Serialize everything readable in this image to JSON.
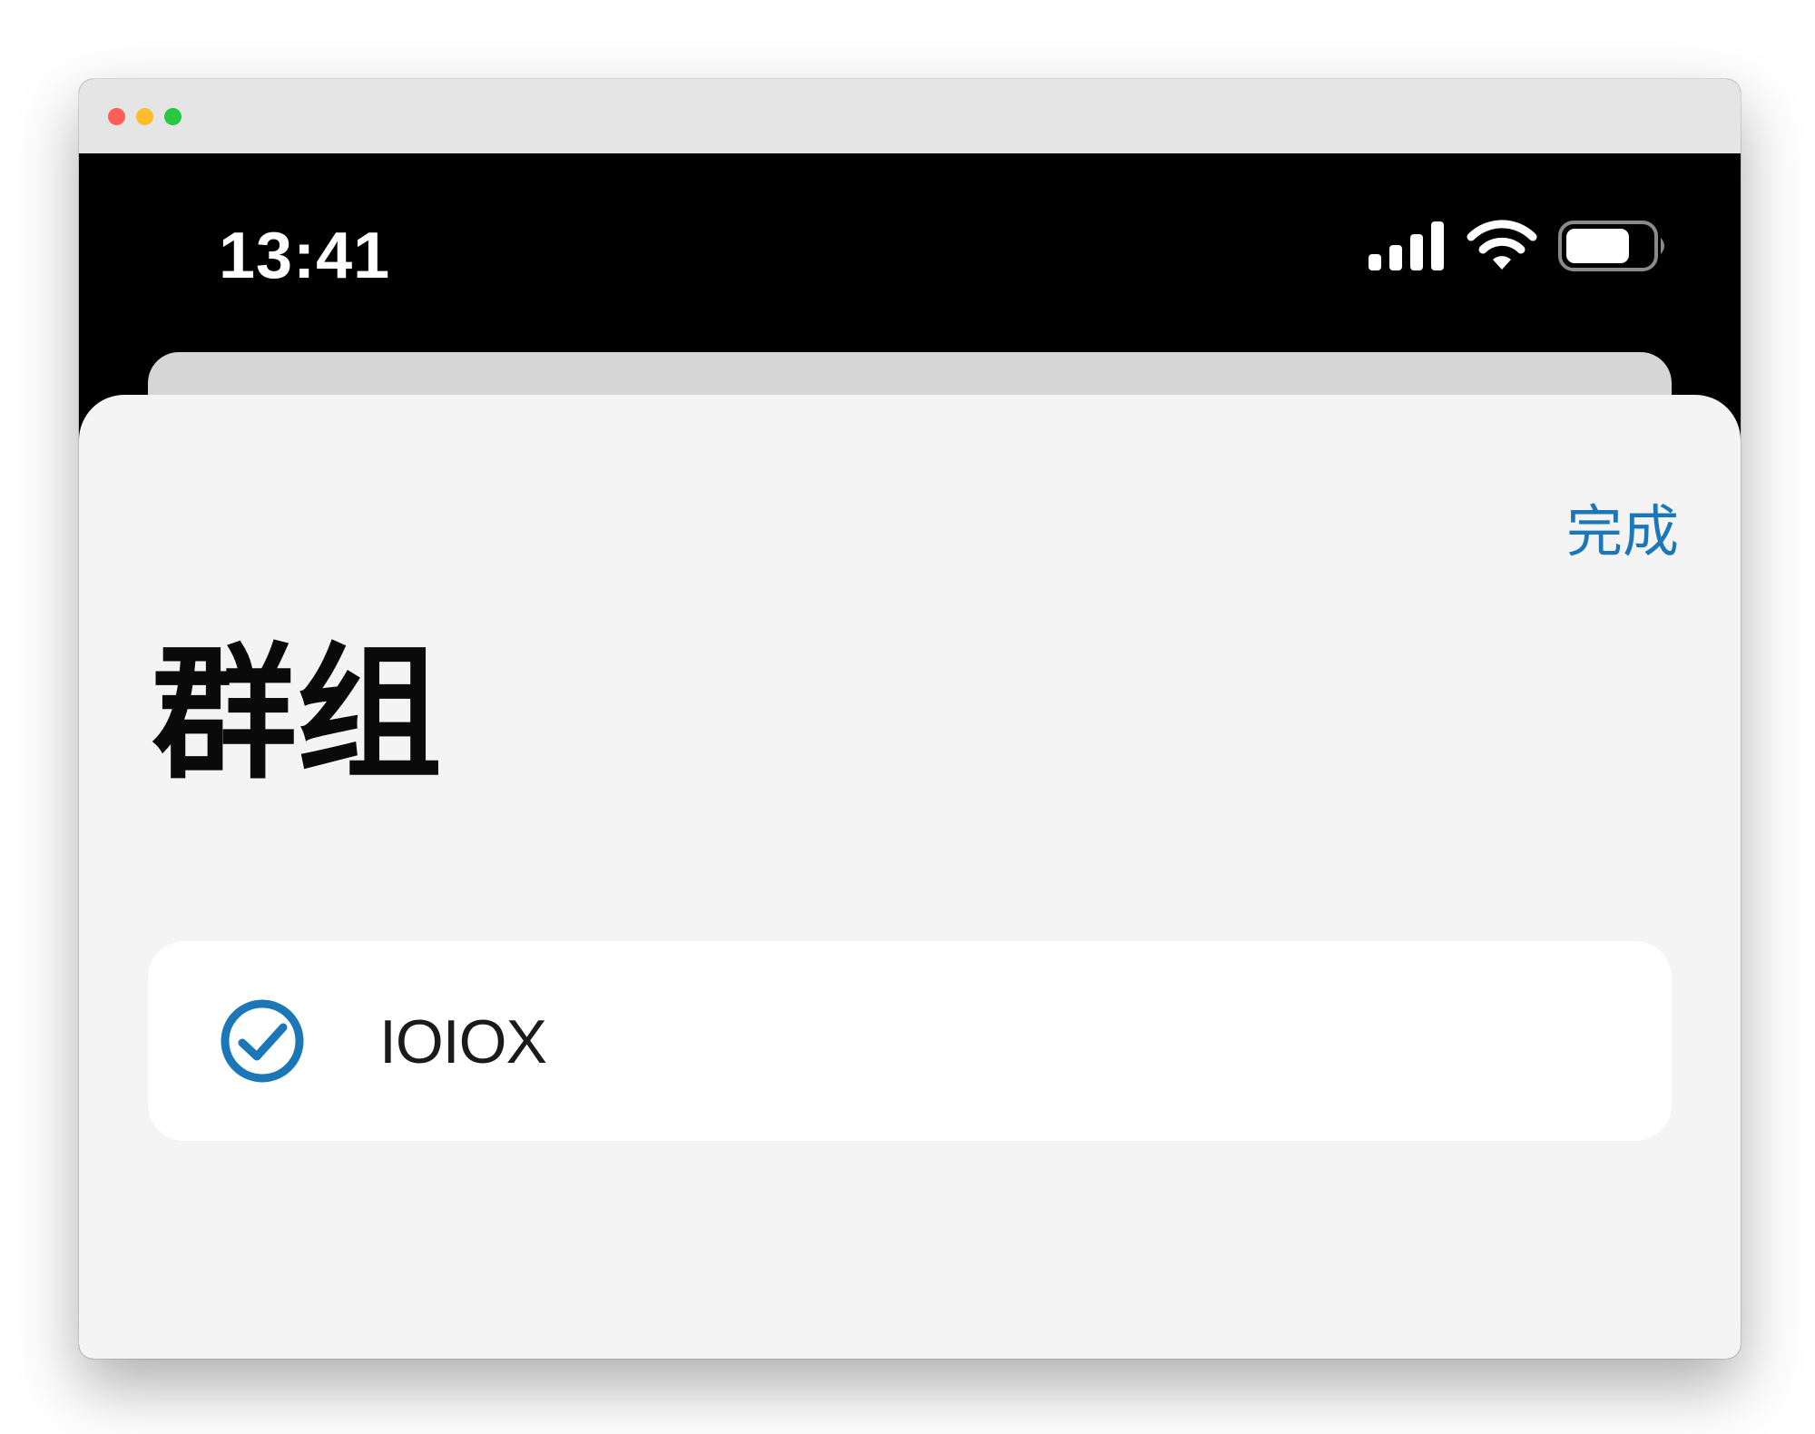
{
  "status_bar": {
    "time": "13:41",
    "battery_level": 0.75
  },
  "sheet": {
    "done_label": "完成",
    "title": "群组",
    "groups": [
      {
        "label": "IOIOX",
        "selected": true
      }
    ]
  },
  "colors": {
    "accent": "#1b77b8",
    "sheet_background": "#f4f4f4",
    "card_background": "#ffffff"
  }
}
